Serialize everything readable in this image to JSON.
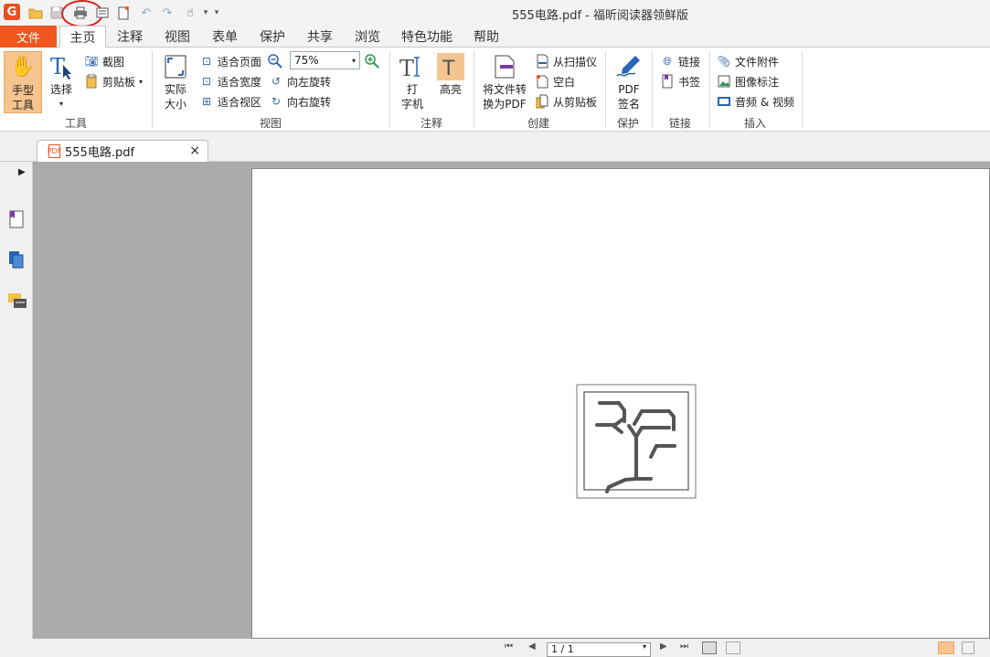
{
  "window": {
    "title": "555电路.pdf - 福昕阅读器领鲜版"
  },
  "menu": {
    "file": "文件",
    "tabs": [
      "主页",
      "注释",
      "视图",
      "表单",
      "保护",
      "共享",
      "浏览",
      "特色功能",
      "帮助"
    ]
  },
  "ribbon": {
    "tools": {
      "hand": "手型\n工具",
      "hand_l1": "手型",
      "hand_l2": "工具",
      "select": "选择",
      "screenshot": "截图",
      "clipboard": "剪贴板",
      "label": "工具"
    },
    "view": {
      "actual_l1": "实际",
      "actual_l2": "大小",
      "fit_page": "适合页面",
      "fit_width": "适合宽度",
      "fit_visible": "适合视区",
      "zoom": "75%",
      "rotate_left": "向左旋转",
      "rotate_right": "向右旋转",
      "label": "视图"
    },
    "comment": {
      "type_l1": "打",
      "type_l2": "字机",
      "highlight": "高亮",
      "label": "注释"
    },
    "create": {
      "convert_l1": "将文件转",
      "convert_l2": "换为PDF",
      "from_scanner": "从扫描仪",
      "blank": "空白",
      "from_clipboard": "从剪贴板",
      "label": "创建"
    },
    "protect": {
      "sign_l1": "PDF",
      "sign_l2": "签名",
      "label": "保护"
    },
    "links": {
      "link": "链接",
      "bookmark": "书签",
      "label": "链接"
    },
    "insert": {
      "attachment": "文件附件",
      "image_annot": "图像标注",
      "av": "音频 & 视频",
      "label": "插入"
    }
  },
  "document": {
    "tab_name": "555电路.pdf",
    "close": "×",
    "badge": "PDF"
  },
  "status": {
    "page": "1 / 1"
  },
  "colors": {
    "accent": "#f0561d",
    "highlight_btn": "#f6c48f",
    "doc_bg": "#ababab"
  }
}
